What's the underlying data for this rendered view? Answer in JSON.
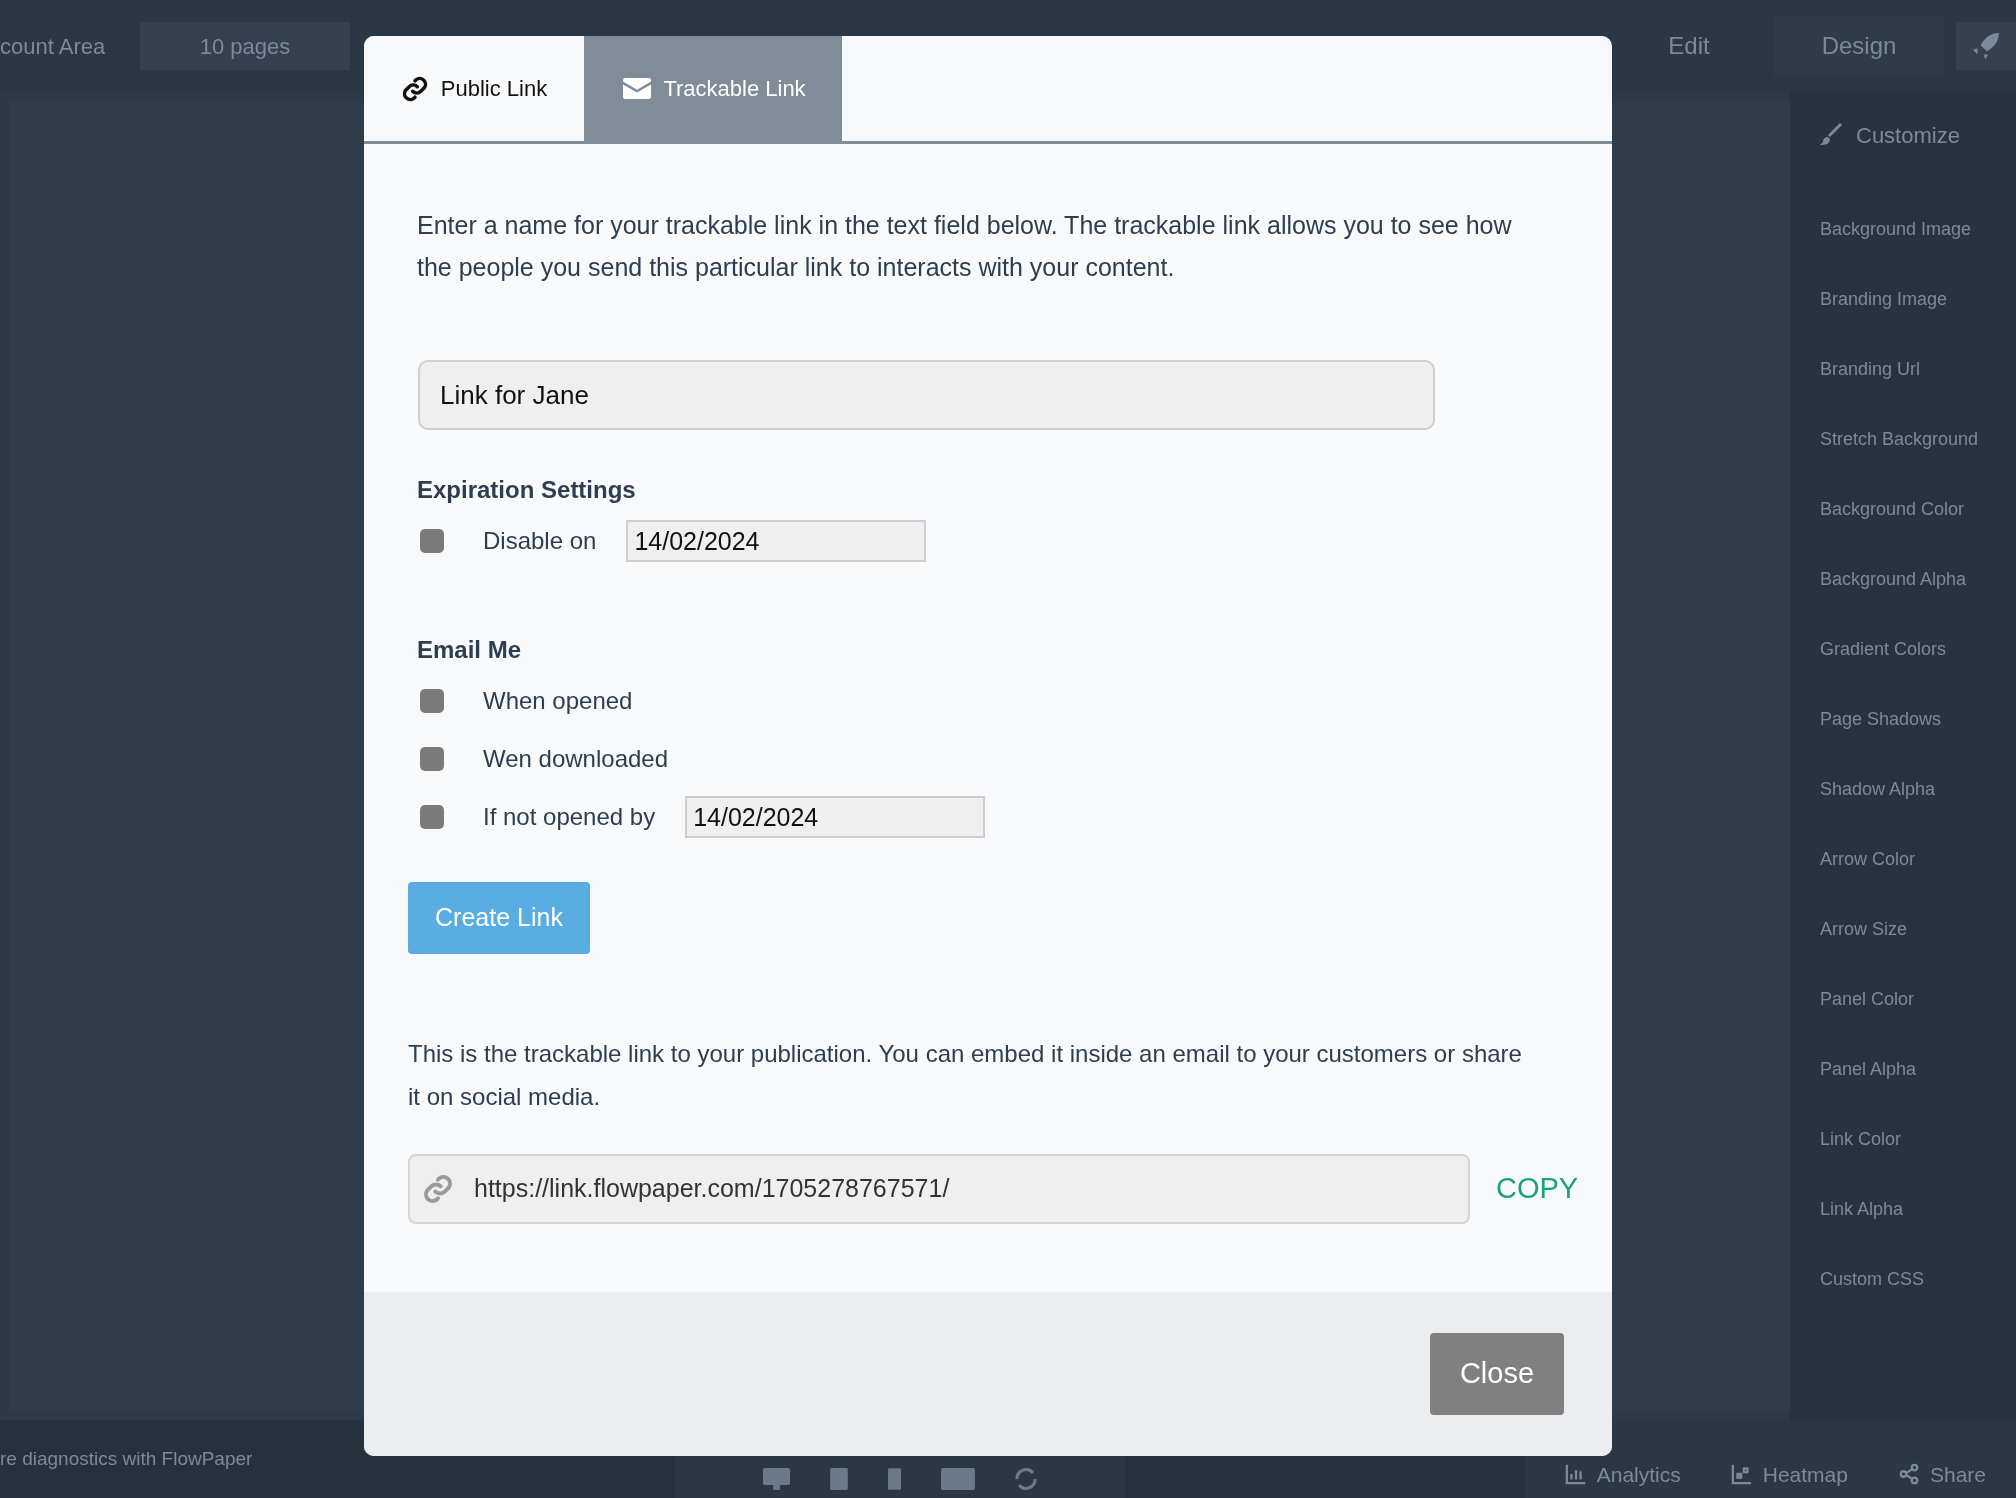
{
  "app_header": {
    "account_area": "count Area",
    "pages_select": "10 pages",
    "mode_buttons": [
      "Edit",
      "Design"
    ]
  },
  "sidebar": {
    "title": "Customize",
    "items": [
      "Background Image",
      "Branding Image",
      "Branding Url",
      "Stretch Background",
      "Background Color",
      "Background Alpha",
      "Gradient Colors",
      "Page Shadows",
      "Shadow Alpha",
      "Arrow Color",
      "Arrow Size",
      "Panel Color",
      "Panel Alpha",
      "Link Color",
      "Link Alpha",
      "Custom CSS"
    ]
  },
  "bottom_bar": {
    "status_text": "re diagnostics with FlowPaper",
    "actions": [
      "Analytics",
      "Heatmap",
      "Share"
    ]
  },
  "dialog": {
    "tabs": [
      {
        "label": "Public Link",
        "selected": false
      },
      {
        "label": "Trackable Link",
        "selected": true
      }
    ],
    "description": "Enter a name for your trackable link in the text field below. The trackable link allows you to see how the people you send this particular link to interacts with your content.",
    "name_field": {
      "value": "Link for Jane"
    },
    "expiration": {
      "heading": "Expiration Settings",
      "options": [
        {
          "label": "Disable on",
          "checked": false,
          "date": "14/02/2024"
        }
      ]
    },
    "email_me": {
      "heading": "Email Me",
      "options": [
        {
          "label": "When opened",
          "checked": false
        },
        {
          "label": "Wen downloaded",
          "checked": false
        },
        {
          "label": "If not opened by",
          "checked": false,
          "date": "14/02/2024"
        }
      ]
    },
    "create_button": "Create Link",
    "link_description": "This is the trackable link to your publication. You can embed it inside an email to your customers or share it on social media.",
    "link_url": "https://link.flowpaper.com/1705278767571/",
    "copy_label": "COPY",
    "close_button": "Close"
  }
}
